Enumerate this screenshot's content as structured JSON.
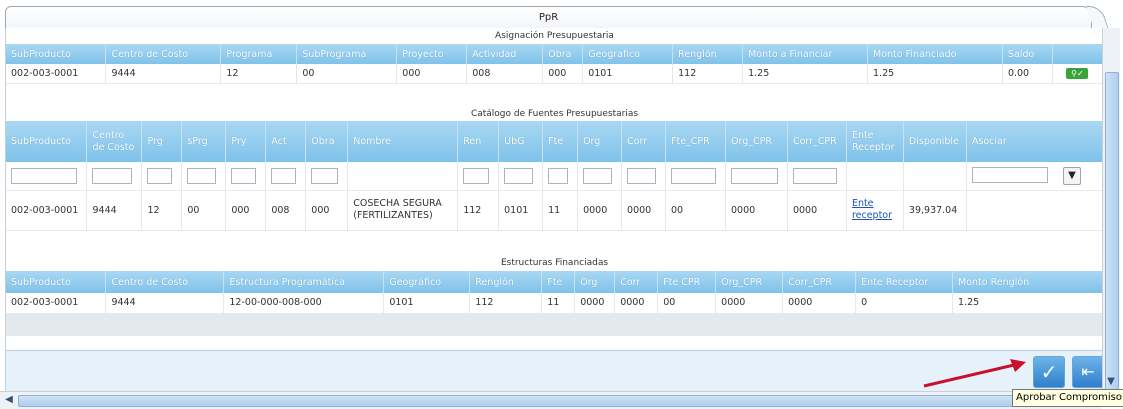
{
  "tab": {
    "title": "PpR"
  },
  "asignacion": {
    "title": "Asignación Presupuestaria",
    "columns": [
      "SubProducto",
      "Centro de Costo",
      "Programa",
      "SubPrograma",
      "Proyecto",
      "Actividad",
      "Obra",
      "Geografico",
      "Renglón",
      "Monto a Financiar",
      "Monto Financiado",
      "Saldo",
      ""
    ],
    "row": [
      "002-003-0001",
      "9444",
      "12",
      "00",
      "000",
      "008",
      "000",
      "0101",
      "112",
      "1.25",
      "1.25",
      "0.00"
    ]
  },
  "catalogo": {
    "title": "Catálogo de Fuentes Presupuestarias",
    "columns": [
      "SubProducto",
      "Centro de Costo",
      "Prg",
      "sPrg",
      "Pry",
      "Act",
      "Obra",
      "Nombre",
      "Ren",
      "UbG",
      "Fte",
      "Org",
      "Corr",
      "Fte_CPR",
      "Org_CPR",
      "Corr_CPR",
      "Ente Receptor",
      "Disponible",
      "Asociar"
    ],
    "row": [
      "002-003-0001",
      "9444",
      "12",
      "00",
      "000",
      "008",
      "000",
      "COSECHA SEGURA (FERTILIZANTES)",
      "112",
      "0101",
      "11",
      "0000",
      "0000",
      "00",
      "0000",
      "0000",
      "Ente receptor",
      "39,937.04",
      ""
    ]
  },
  "estructuras": {
    "title": "Estructuras Financiadas",
    "columns": [
      "SubProducto",
      "Centro de Costo",
      "Estructura Programática",
      "Geográfico",
      "Renglón",
      "Fte",
      "Org",
      "Corr",
      "Fte CPR",
      "Org_CPR",
      "Corr_CPR",
      "Ente Receptor",
      "Monto Renglón"
    ],
    "row": [
      "002-003-0001",
      "9444",
      "12-00-000-008-000",
      "0101",
      "112",
      "11",
      "0000",
      "0000",
      "00",
      "0000",
      "0000",
      "0",
      "1.25"
    ]
  },
  "footer": {
    "tooltip": "Aprobar Compromiso"
  },
  "icons": {
    "approve": "check-icon",
    "exit": "exit-door-icon",
    "filter": "funnel-icon"
  },
  "colors": {
    "header": "#8ccbef",
    "accent": "#2f7fcc",
    "arrow": "#c8102e"
  }
}
